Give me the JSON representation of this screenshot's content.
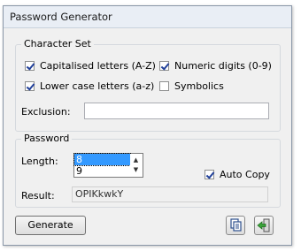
{
  "window": {
    "title": "Password Generator"
  },
  "character_set": {
    "label": "Character Set",
    "options": [
      {
        "label": "Capitalised letters (A-Z)",
        "checked": true
      },
      {
        "label": "Numeric digits (0-9)",
        "checked": true
      },
      {
        "label": "Lower case letters (a-z)",
        "checked": true
      },
      {
        "label": "Symbolics",
        "checked": false
      }
    ],
    "exclusion_label": "Exclusion:",
    "exclusion_value": ""
  },
  "password": {
    "label": "Password",
    "length_label": "Length:",
    "length_options": [
      "8",
      "9"
    ],
    "selected_length": "8",
    "auto_copy_label": "Auto Copy",
    "auto_copy_checked": true,
    "result_label": "Result:",
    "result_value": "OPIKkwkY"
  },
  "actions": {
    "generate_label": "Generate",
    "copy_icon": "copy-icon",
    "exit_icon": "exit-icon"
  }
}
